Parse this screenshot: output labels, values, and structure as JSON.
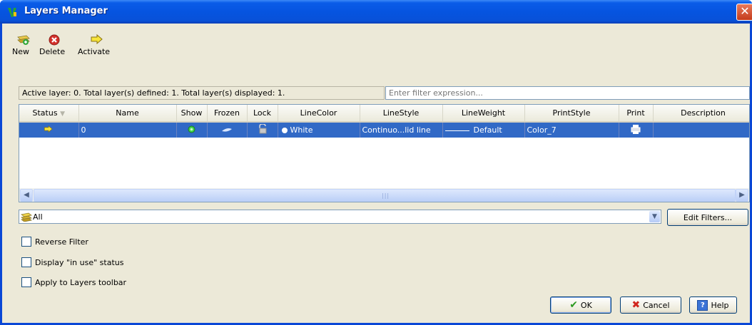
{
  "window": {
    "title": "Layers Manager",
    "close_icon": "close-icon"
  },
  "toolbar": {
    "new_label": "New",
    "delete_label": "Delete",
    "activate_label": "Activate"
  },
  "status_text": "Active layer: 0. Total layer(s) defined: 1. Total layer(s) displayed: 1.",
  "filter": {
    "placeholder": "Enter filter expression..."
  },
  "table": {
    "columns": [
      "Status",
      "Name",
      "Show",
      "Frozen",
      "Lock",
      "LineColor",
      "LineStyle",
      "LineWeight",
      "PrintStyle",
      "Print",
      "Description"
    ],
    "rows": [
      {
        "name": "0",
        "line_color": "White",
        "line_style": "Continuo...lid line",
        "line_weight": "Default",
        "print_style": "Color_7",
        "description": ""
      }
    ]
  },
  "filter_combo": {
    "value": "All"
  },
  "buttons": {
    "edit_filters": "Edit Filters...",
    "ok": "OK",
    "cancel": "Cancel",
    "help": "Help"
  },
  "options": {
    "reverse_filter": "Reverse Filter",
    "display_in_use": "Display \"in use\" status",
    "apply_toolbar": "Apply to Layers toolbar"
  },
  "colors": {
    "title_blue": "#0654e0",
    "selection": "#3169c6",
    "face": "#ece9d8"
  }
}
